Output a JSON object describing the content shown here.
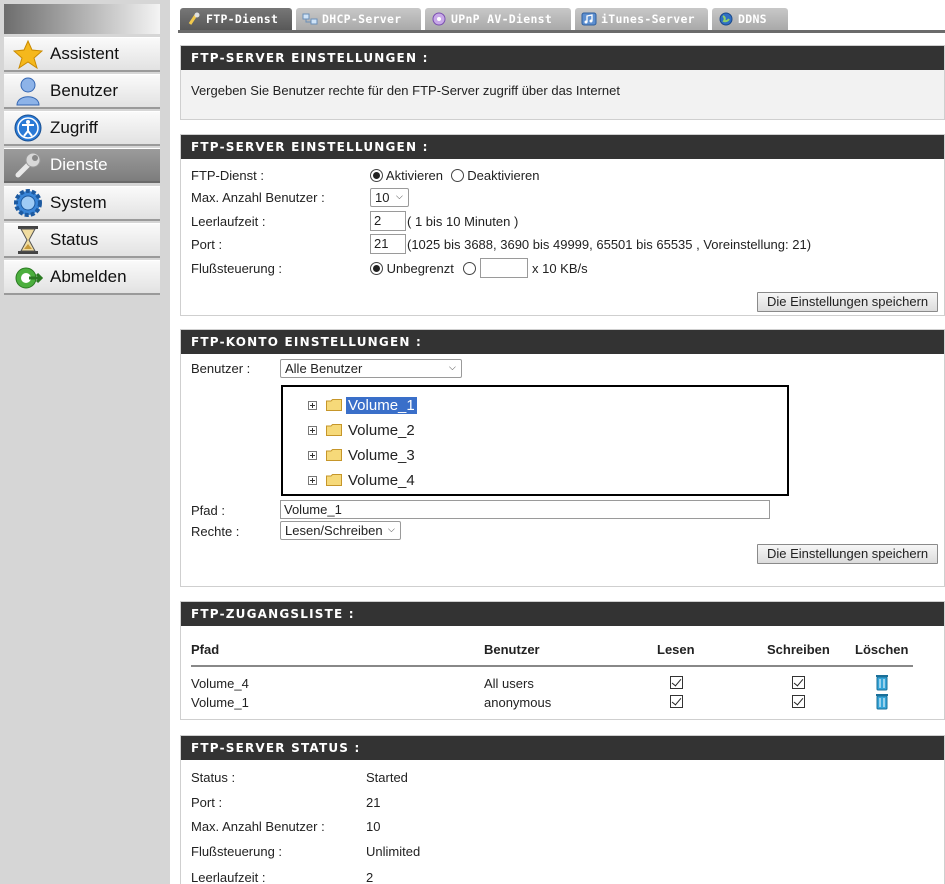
{
  "nav": {
    "items": [
      {
        "label": "Assistent",
        "icon": "star-icon"
      },
      {
        "label": "Benutzer",
        "icon": "user-icon"
      },
      {
        "label": "Zugriff",
        "icon": "access-icon"
      },
      {
        "label": "Dienste",
        "icon": "wrench-icon"
      },
      {
        "label": "System",
        "icon": "gear-icon"
      },
      {
        "label": "Status",
        "icon": "hourglass-icon"
      },
      {
        "label": "Abmelden",
        "icon": "logout-icon"
      }
    ]
  },
  "tabs": [
    {
      "label": "FTP-Dienst",
      "icon": "ftp-icon"
    },
    {
      "label": "DHCP-Server",
      "icon": "network-icon"
    },
    {
      "label": "UPnP AV-Dienst",
      "icon": "media-icon"
    },
    {
      "label": "iTunes-Server",
      "icon": "music-icon"
    },
    {
      "label": "DDNS",
      "icon": "globe-icon"
    }
  ],
  "intro": {
    "title": "FTP-SERVER EINSTELLUNGEN :",
    "text": "Vergeben Sie Benutzer rechte für den FTP-Server zugriff über das Internet"
  },
  "server_settings": {
    "title": "FTP-SERVER EINSTELLUNGEN :",
    "ftp_label": "FTP-Dienst :",
    "ftp_on": "Aktivieren",
    "ftp_off": "Deaktivieren",
    "max_users_label": "Max. Anzahl Benutzer :",
    "max_users_value": "10",
    "idle_label": "Leerlaufzeit :",
    "idle_value": "2",
    "idle_hint": "( 1 bis 10 Minuten )",
    "port_label": "Port :",
    "port_value": "21",
    "port_hint": "(1025 bis 3688, 3690 bis 49999, 65501 bis 65535 , Voreinstellung: 21)",
    "flow_label": "Flußsteuerung :",
    "flow_unlimited": "Unbegrenzt",
    "flow_value": "",
    "flow_unit": "x 10 KB/s",
    "save_label": "Die Einstellungen speichern"
  },
  "account_settings": {
    "title": "FTP-KONTO EINSTELLUNGEN :",
    "user_label": "Benutzer :",
    "user_value": "Alle Benutzer",
    "tree": [
      "Volume_1",
      "Volume_2",
      "Volume_3",
      "Volume_4"
    ],
    "path_label": "Pfad :",
    "path_value": "Volume_1",
    "rights_label": "Rechte :",
    "rights_value": "Lesen/Schreiben",
    "save_label": "Die Einstellungen speichern"
  },
  "access_list": {
    "title": "FTP-ZUGANGSLISTE :",
    "headers": {
      "path": "Pfad",
      "user": "Benutzer",
      "read": "Lesen",
      "write": "Schreiben",
      "delete": "Löschen"
    },
    "rows": [
      {
        "path": "Volume_4",
        "user": "All users",
        "read": true,
        "write": true
      },
      {
        "path": "Volume_1",
        "user": "anonymous",
        "read": true,
        "write": true
      }
    ]
  },
  "status": {
    "title": "FTP-SERVER STATUS :",
    "status_label": "Status :",
    "status_value": "Started",
    "port_label": "Port :",
    "port_value": "21",
    "max_label": "Max. Anzahl Benutzer :",
    "max_value": "10",
    "flow_label": "Flußsteuerung :",
    "flow_value": "Unlimited",
    "idle_label": "Leerlaufzeit :",
    "idle_value": "2"
  },
  "colors": {
    "panel_header": "#333333",
    "nav_background": "#d6d6d6",
    "selection": "#3a6fc9"
  }
}
